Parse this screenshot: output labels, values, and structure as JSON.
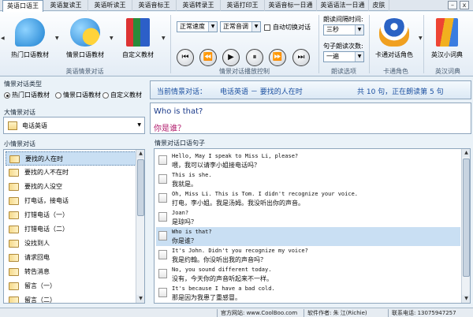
{
  "tabs": [
    {
      "label": "英语口语王",
      "active": true
    },
    {
      "label": "英语复读王"
    },
    {
      "label": "英语听读王"
    },
    {
      "label": "英语音标王"
    },
    {
      "label": "英语转录王"
    },
    {
      "label": "英语打印王"
    },
    {
      "label": "英语音标一日通"
    },
    {
      "label": "英语语法一日通"
    },
    {
      "label": "皮肤"
    }
  ],
  "window_buttons": {
    "minimize": "–",
    "close": "x"
  },
  "toolbar": {
    "groups": {
      "scene": "英语情景对话",
      "playback": "情景对话播放控制",
      "read_options": "朗读选项",
      "character": "卡通角色",
      "dictionary": "英汉词典"
    },
    "buttons": {
      "hot_material": "热门口语教材",
      "scene_material": "情景口语教材",
      "custom_material": "自定义教材",
      "cartoon_role": "卡通对话角色",
      "dictionary": "英汉小词典"
    },
    "speed_select": "正常速度",
    "voice_select": "正常音调",
    "auto_switch_label": "自动切换对话",
    "auto_switch_checked": false,
    "interval_label": "朗读间隔时间:",
    "interval_value": "三秒",
    "repeat_label": "句子朗读次数:",
    "repeat_value": "一遍",
    "playback_icons": [
      "skip-first-icon",
      "rewind-icon",
      "play-icon",
      "pause-icon",
      "fast-forward-icon",
      "skip-last-icon"
    ]
  },
  "left": {
    "type_heading": "情景对话类型",
    "type_options": [
      {
        "label": "热门口语教材",
        "selected": true
      },
      {
        "label": "情景口语教材",
        "selected": false
      },
      {
        "label": "自定义教材",
        "selected": false
      }
    ],
    "big_heading": "大情景对话",
    "big_selected": "电话英语",
    "small_heading": "小情景对话",
    "small_items": [
      {
        "label": "要找的人在时",
        "selected": true
      },
      {
        "label": "要找的人不在时"
      },
      {
        "label": "要找的人没空"
      },
      {
        "label": "打电话，接电话"
      },
      {
        "label": "打错电话（一）"
      },
      {
        "label": "打错电话（二）"
      },
      {
        "label": "没找到人"
      },
      {
        "label": "请求回电"
      },
      {
        "label": "转告消息"
      },
      {
        "label": "留言（一）"
      },
      {
        "label": "留言（二）"
      }
    ]
  },
  "right": {
    "current_prefix": "当前情景对话：",
    "current_scene": "电话英语 － 要找的人在时",
    "progress_text": "共 10 句，正在朗读第 5 句",
    "current_en": "Who is that?",
    "current_cn": "你是谁？",
    "sentences_heading": "情景对话口语句子",
    "sentences": [
      {
        "en": "Hello, May I speak to Miss Li, please?",
        "cn": "喂，我可以请李小姐接电话吗？"
      },
      {
        "en": "This is she.",
        "cn": "我就是。"
      },
      {
        "en": "Oh, Miss Li. This is Tom. I didn't recognize your voice.",
        "cn": "打电，李小姐。我是汤姆。我没听出你的声音。"
      },
      {
        "en": "Joan?",
        "cn": "是琼吗？"
      },
      {
        "en": "Who is that?",
        "cn": "你是谁？",
        "selected": true
      },
      {
        "en": "It's John. Didn't you recognize my voice?",
        "cn": "我是约翰。你没听出我的声音吗？"
      },
      {
        "en": "No, you sound different today.",
        "cn": "没有，今天你的声音听起来不一样。"
      },
      {
        "en": "It's because I have a bad cold.",
        "cn": "那是因为我患了重感冒。"
      }
    ]
  },
  "status": {
    "website": "官方网站: www.CoolBoo.com",
    "author": "软件作者: 朱 江(Richie)",
    "phone": "联系电话: 13075947257"
  },
  "colors": {
    "accent": "#1a4fa0",
    "selection": "#c9dff3",
    "chinese_text": "#b0186a"
  }
}
